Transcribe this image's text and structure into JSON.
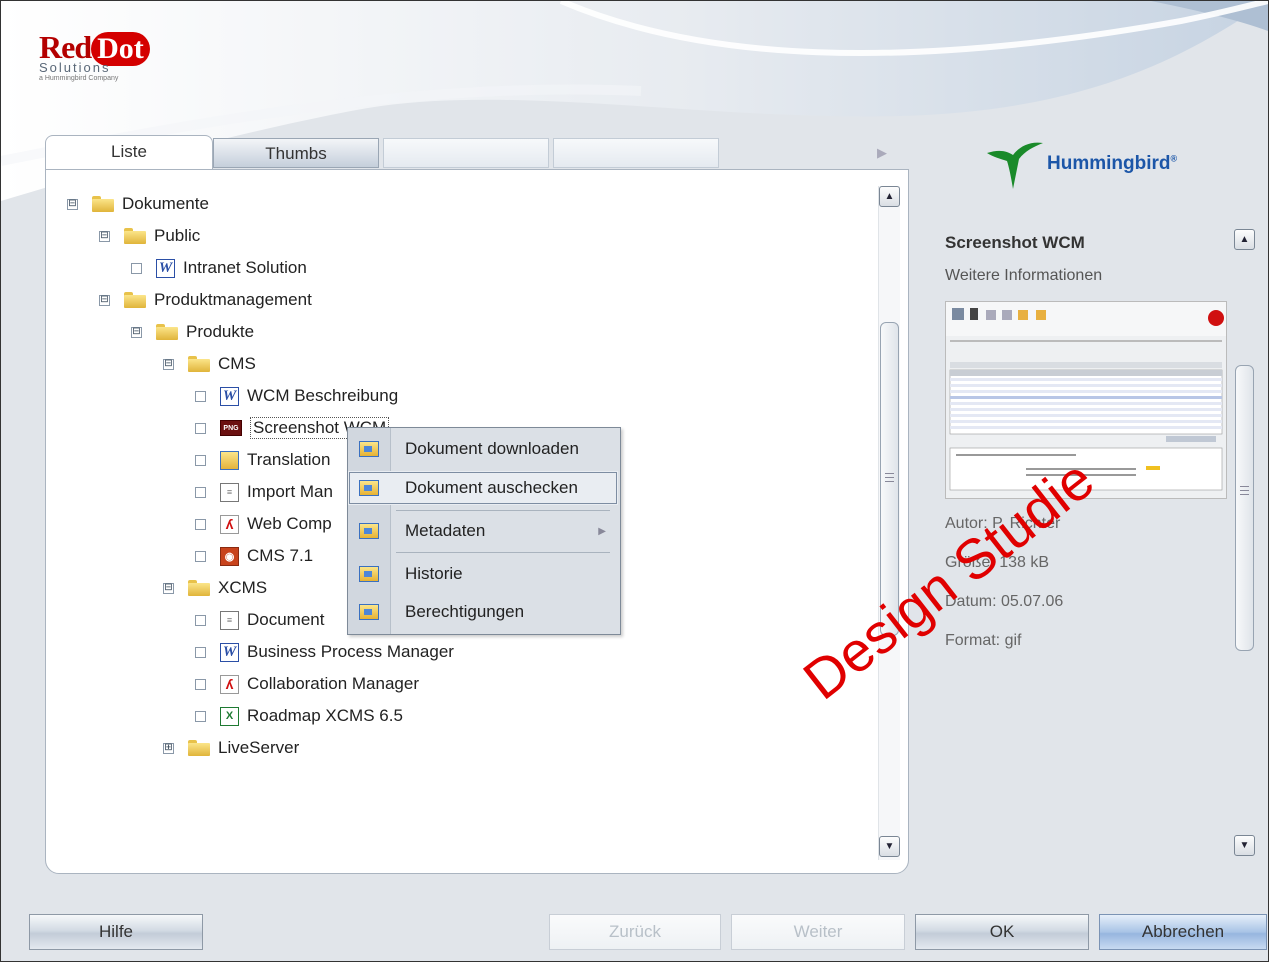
{
  "brand": {
    "name_part1": "Red",
    "name_part2": "Dot",
    "solutions": "Solutions",
    "tagline": "a Hummingbird Company",
    "partner": "Hummingbird",
    "partner_mark": "®"
  },
  "tabs": [
    {
      "label": "Liste",
      "active": true
    },
    {
      "label": "Thumbs",
      "active": false
    },
    {
      "label": "",
      "active": false
    },
    {
      "label": "",
      "active": false
    }
  ],
  "tree": [
    {
      "label": "Dokumente",
      "icon": "folder-icon",
      "toggle": "⊟"
    },
    {
      "label": "Public",
      "icon": "folder-icon",
      "toggle": "⊟"
    },
    {
      "label": "Intranet Solution",
      "icon": "word-doc-icon"
    },
    {
      "label": "Produktmanagement",
      "icon": "folder-icon",
      "toggle": "⊟"
    },
    {
      "label": "Produkte",
      "icon": "folder-icon",
      "toggle": "⊟"
    },
    {
      "label": "CMS",
      "icon": "folder-icon",
      "toggle": "⊟"
    },
    {
      "label": "WCM Beschreibung",
      "icon": "word-doc-icon"
    },
    {
      "label": "Screenshot WCM",
      "icon": "png-file-icon",
      "selected": true
    },
    {
      "label": "Translation",
      "icon": "generic-doc-icon"
    },
    {
      "label": "Import Man",
      "icon": "text-doc-icon"
    },
    {
      "label": "Web Comp",
      "icon": "pdf-doc-icon"
    },
    {
      "label": "CMS 7.1",
      "icon": "ppt-doc-icon"
    },
    {
      "label": "XCMS",
      "icon": "folder-icon",
      "toggle": "⊟"
    },
    {
      "label": "Document",
      "icon": "text-doc-icon"
    },
    {
      "label": "Business Process Manager",
      "icon": "word-doc-icon"
    },
    {
      "label": "Collaboration Manager",
      "icon": "pdf-doc-icon"
    },
    {
      "label": "Roadmap XCMS 6.5",
      "icon": "excel-doc-icon"
    },
    {
      "label": "LiveServer",
      "icon": "folder-icon",
      "toggle": "⊞"
    }
  ],
  "context_menu": [
    {
      "label": "Dokument downloaden"
    },
    {
      "label": "Dokument auschecken",
      "highlighted": true
    },
    {
      "label": "Metadaten",
      "submenu": true
    },
    {
      "label": "Historie"
    },
    {
      "label": "Berechtigungen"
    }
  ],
  "info": {
    "title": "Screenshot WCM",
    "subtitle": "Weitere Informationen",
    "author": "Autor: P. Richter",
    "size": "Größe: 138 kB",
    "date": "Datum: 05.07.06",
    "format": "Format: gif"
  },
  "watermark": "Design Studie",
  "buttons": {
    "help": "Hilfe",
    "back": "Zurück",
    "next": "Weiter",
    "ok": "OK",
    "cancel": "Abbrechen"
  },
  "colors": {
    "accent_blue": "#1c56a8",
    "brand_red": "#d40000",
    "watermark_red": "#e00000"
  }
}
